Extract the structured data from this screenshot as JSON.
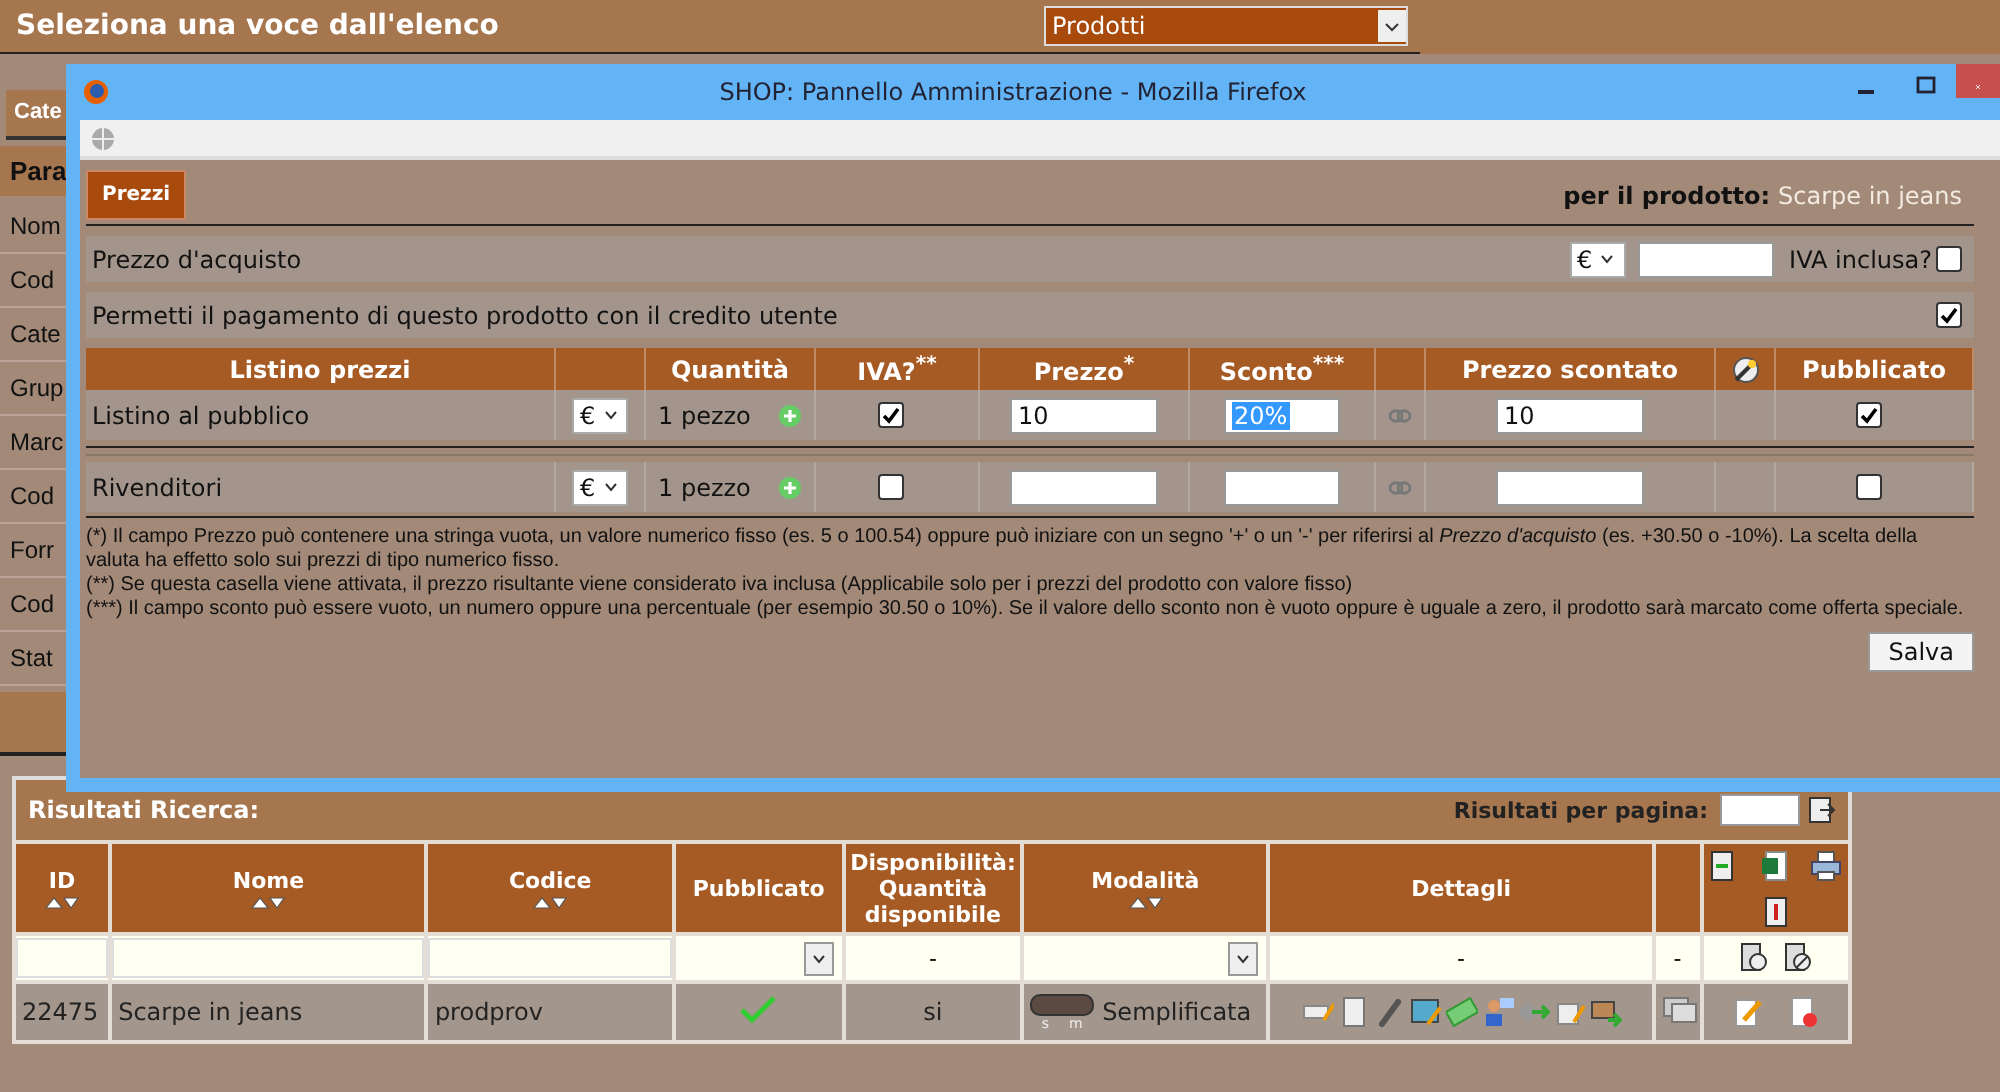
{
  "header": {
    "title": "Seleziona una voce dall'elenco",
    "select": "Prodotti"
  },
  "sidebar": {
    "tab": "Cate",
    "heading": "Para",
    "items": [
      "Nom",
      "Cod",
      "Cate",
      "Grup",
      "Marc",
      "Cod",
      "Forr",
      "Cod",
      "Stat"
    ]
  },
  "popup": {
    "title": "SHOP: Pannello Amministrazione - Mozilla Firefox",
    "tab": {
      "label": "Prezzi",
      "selected": true
    },
    "product_label": "per il prodotto:",
    "product_name": "Scarpe in jeans",
    "purchase": {
      "label": "Prezzo d'acquisto",
      "currency": "€",
      "vat_label": "IVA inclusa?",
      "vat_included": false
    },
    "credit": {
      "label": "Permetti il pagamento di questo prodotto con il credito utente",
      "checked": true
    },
    "price_columns": [
      "Listino prezzi",
      "Quantità",
      "IVA?$^{**}$",
      "Prezzo$^{*}$",
      "Sconto$^{***}$",
      "Prezzo scontato",
      "Pubblicato"
    ],
    "price_rows": [
      {
        "name": "Listino al pubblico",
        "currency": "€",
        "quantity": "1 pezzo",
        "vat": true,
        "price": "10",
        "discount": "20%",
        "discount_selected": true,
        "discounted_price": "10",
        "published": true
      },
      {
        "name": "Rivenditori",
        "currency": "€",
        "quantity": "1 pezzo",
        "vat": false,
        "published": false
      }
    ],
    "notes": [
      "(*) Il campo Prezzo può contenere una stringa vuota, un valore numerico fisso (es. 5 o 100.54) oppure può iniziare con un segno '+' o un '-' per riferirsi al *Prezzo d'acquisto* (es. +30.50 o -10%). La scelta della valuta ha effetto solo sui prezzi di tipo numerico fisso.",
      "(**) Se questa casella viene attivata, il prezzo risultante viene considerato iva inclusa (Applicabile solo per i prezzi del prodotto con valore fisso)",
      "(***) Il campo sconto può essere vuoto, un numero oppure una percentuale (per esempio 30.50 o 10%). Se il valore dello sconto non è vuoto oppure è uguale a zero, il prodotto sarà marcato come offerta speciale."
    ],
    "save": "Salva"
  },
  "results": {
    "title": "Risultati Ricerca:",
    "per_page_label": "Risultati per pagina:",
    "columns": [
      {
        "label": "ID",
        "sortable": true
      },
      {
        "label": "Nome",
        "sortable": true
      },
      {
        "label": "Codice",
        "sortable": true
      },
      {
        "label": "Pubblicato",
        "sortable": false
      },
      {
        "label": "Disponibilità: Quantità disponibile",
        "sortable": false
      },
      {
        "label": "Modalità",
        "sortable": true
      },
      {
        "label": "Dettagli",
        "sortable": false
      }
    ],
    "filters": {
      "availability": "-",
      "details": "-",
      "extra": "-"
    },
    "rows": [
      {
        "id": "22475",
        "name": "Scarpe in jeans",
        "code": "prodprov",
        "published": true,
        "availability": "si",
        "toggle_labels": [
          "s",
          "m"
        ],
        "mode": "Semplificata"
      }
    ]
  }
}
